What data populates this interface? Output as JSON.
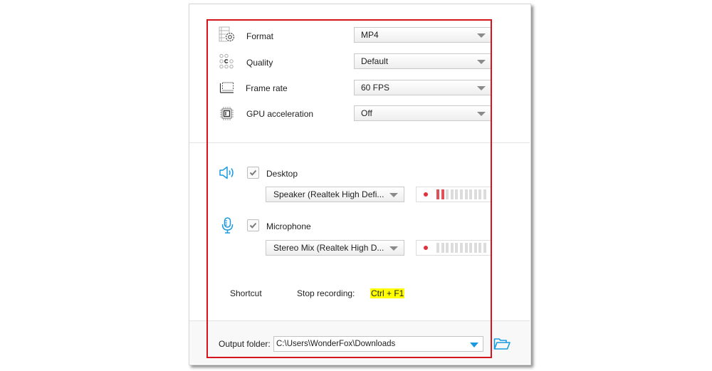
{
  "settings": {
    "rows": [
      {
        "id": "format",
        "icon": "format-gear-icon",
        "label": "Format",
        "value": "MP4"
      },
      {
        "id": "quality",
        "icon": "quality-dots-icon",
        "label": "Quality",
        "value": "Default"
      },
      {
        "id": "frame-rate",
        "icon": "frame-rate-icon",
        "label": "Frame rate",
        "value": "60 FPS"
      },
      {
        "id": "gpu",
        "icon": "gpu-chip-icon",
        "label": "GPU acceleration",
        "value": "Off"
      }
    ]
  },
  "audio": {
    "desktop": {
      "icon": "speaker-icon",
      "checked": true,
      "label": "Desktop",
      "device": "Speaker (Realtek High Defi...",
      "meter": {
        "active_bars": 2,
        "total_bars": 11
      }
    },
    "microphone": {
      "icon": "microphone-icon",
      "checked": true,
      "label": "Microphone",
      "device": "Stereo Mix (Realtek High D...",
      "meter": {
        "active_bars": 0,
        "total_bars": 11
      }
    }
  },
  "shortcut": {
    "title": "Shortcut",
    "action_label": "Stop recording:",
    "keys": "Ctrl + F1"
  },
  "output": {
    "label": "Output folder:",
    "path": "C:\\Users\\WonderFox\\Downloads",
    "browse_icon": "folder-open-icon"
  },
  "colors": {
    "accent": "#1b9ae0",
    "highlight_box": "#d7141c",
    "meter_active": "#e05058",
    "shortcut_highlight": "#ffff00"
  }
}
